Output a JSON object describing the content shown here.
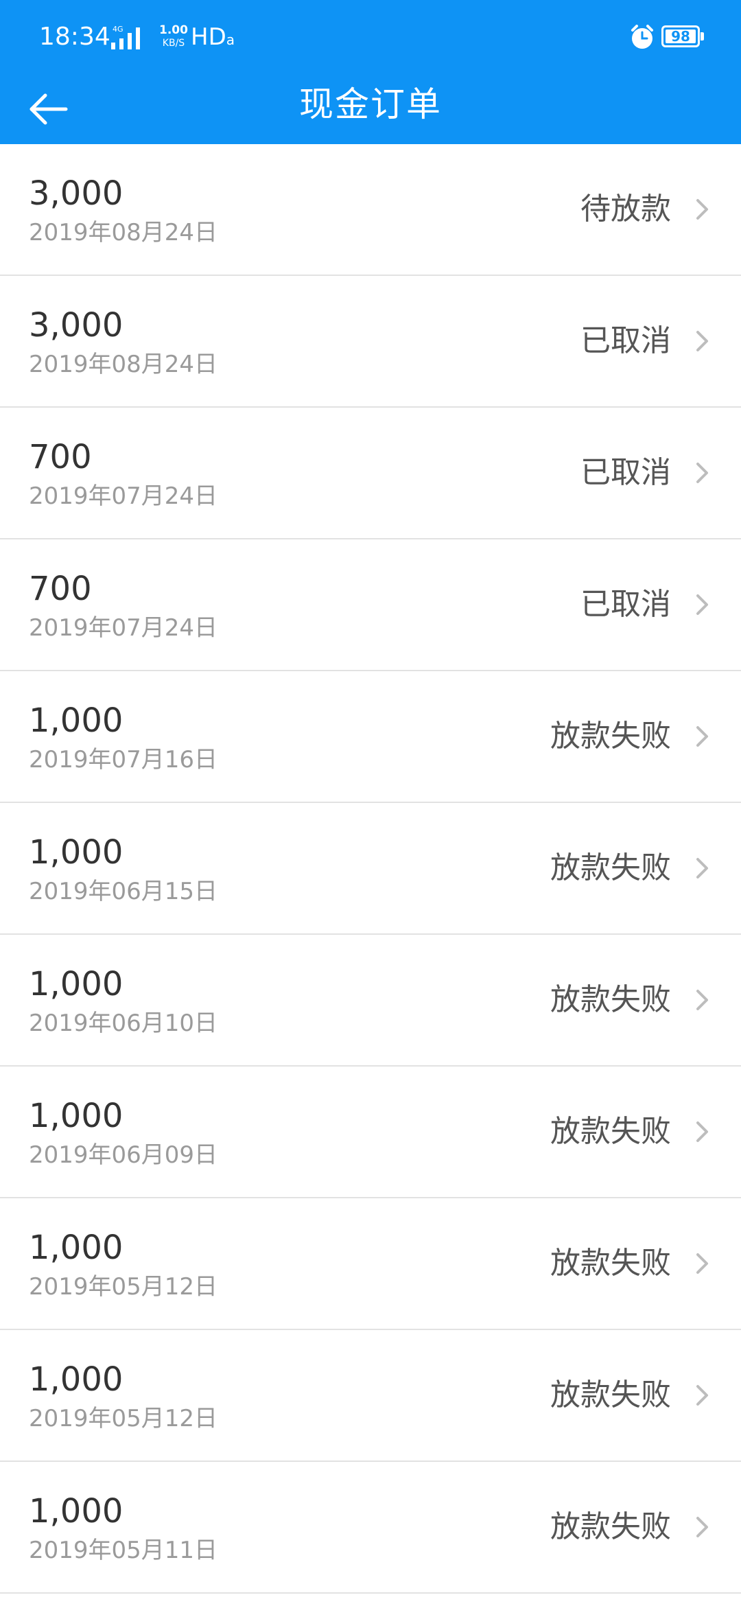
{
  "status_bar": {
    "time": "18:34",
    "network": "4G",
    "speed_value": "1.00",
    "speed_unit": "KB/S",
    "hd_label": "HD",
    "hd_sub": "a",
    "battery": "98",
    "icons": [
      "signal-icon",
      "alarm-icon",
      "battery-icon"
    ]
  },
  "header": {
    "title": "现金订单",
    "back_icon": "arrow-left-icon"
  },
  "orders": [
    {
      "amount": "3,000",
      "date": "2019年08月24日",
      "status": "待放款"
    },
    {
      "amount": "3,000",
      "date": "2019年08月24日",
      "status": "已取消"
    },
    {
      "amount": "700",
      "date": "2019年07月24日",
      "status": "已取消"
    },
    {
      "amount": "700",
      "date": "2019年07月24日",
      "status": "已取消"
    },
    {
      "amount": "1,000",
      "date": "2019年07月16日",
      "status": "放款失败"
    },
    {
      "amount": "1,000",
      "date": "2019年06月15日",
      "status": "放款失败"
    },
    {
      "amount": "1,000",
      "date": "2019年06月10日",
      "status": "放款失败"
    },
    {
      "amount": "1,000",
      "date": "2019年06月09日",
      "status": "放款失败"
    },
    {
      "amount": "1,000",
      "date": "2019年05月12日",
      "status": "放款失败"
    },
    {
      "amount": "1,000",
      "date": "2019年05月12日",
      "status": "放款失败"
    },
    {
      "amount": "1,000",
      "date": "2019年05月11日",
      "status": "放款失败"
    }
  ],
  "colors": {
    "header_bg": "#0e93f5",
    "amount_text": "#333333",
    "date_text": "#9a9a9a",
    "status_text": "#555555",
    "divider": "#e2e2e2",
    "chevron": "#bdbdbd"
  }
}
